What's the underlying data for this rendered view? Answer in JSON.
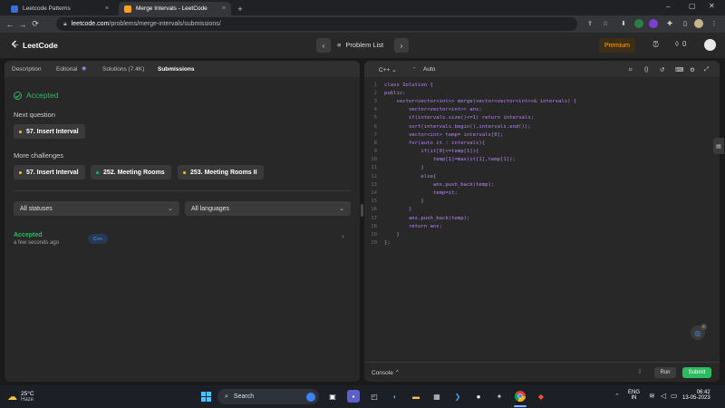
{
  "browser": {
    "tabs": [
      {
        "title": "Leetcode Patterns"
      },
      {
        "title": "Merge Intervals - LeetCode"
      }
    ],
    "url_host": "leetcode.com",
    "url_path": "/problems/merge-intervals/submissions/"
  },
  "header": {
    "logo_text": "LeetCode",
    "problem_list": "Problem List",
    "premium": "Premium",
    "coins": "0"
  },
  "left": {
    "tabs": [
      "Description",
      "Editorial",
      "Solutions (7.4K)",
      "Submissions"
    ],
    "status": "Accepted",
    "next_question_heading": "Next question",
    "next_question": "57. Insert Interval",
    "more_challenges_heading": "More challenges",
    "challenges": [
      "57. Insert Interval",
      "252. Meeting Rooms",
      "253. Meeting Rooms II"
    ],
    "filter_status": "All statuses",
    "filter_language": "All languages",
    "submission": {
      "status": "Accepted",
      "time": "a few seconds ago",
      "language": "C++"
    }
  },
  "editor": {
    "language": "C++",
    "mode": "Auto",
    "lines": [
      "class Solution {",
      "public:",
      "    vector<vector<int>> merge(vector<vector<int>>& intervals) {",
      "        vector<vector<int>> ans;",
      "        if(intervals.size()<=1) return intervals;",
      "        sort(intervals.begin(),intervals.end());",
      "        vector<int> temp= intervals[0];",
      "        for(auto it : intervals){",
      "            if(it[0]<=temp[1]){",
      "                temp[1]=max(it[1],temp[1]);",
      "            }",
      "            else{",
      "                ans.push_back(temp);",
      "                temp=it;",
      "            }",
      "        }",
      "        ans.push_back(temp);",
      "        return ans;",
      "    }",
      "};"
    ],
    "console_label": "Console",
    "run_label": "Run",
    "submit_label": "Submit"
  },
  "taskbar": {
    "weather_temp": "25°C",
    "weather_desc": "Haze",
    "search_label": "Search",
    "lang_top": "ENG",
    "lang_bottom": "IN",
    "time": "06:42",
    "date": "13-05-2023"
  },
  "colors": {
    "accent_green": "#2cbb5d",
    "premium_orange": "#ffa116",
    "panel_bg": "#282828",
    "page_bg": "#1a1a1a"
  }
}
